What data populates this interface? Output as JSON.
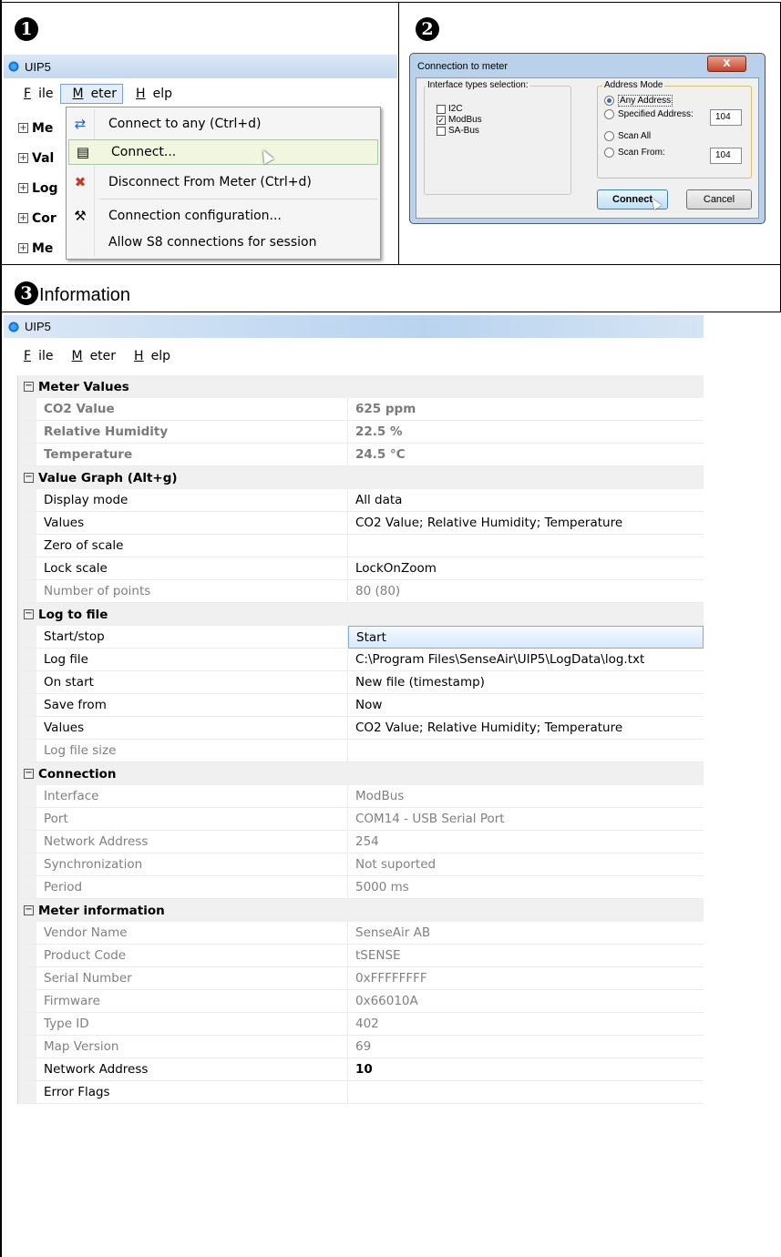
{
  "section_numbers": [
    "1",
    "2",
    "3"
  ],
  "section3_label": "Information",
  "window": {
    "title": "UIP5"
  },
  "menubar": {
    "file": "File",
    "meter": "Meter",
    "help": "Help"
  },
  "tree_collapsed": [
    "Me",
    "Val",
    "Log",
    "Cor",
    "Me"
  ],
  "meter_menu": {
    "items": [
      {
        "label": "Connect to any (Ctrl+d)",
        "icon": "connect-any-icon"
      },
      {
        "label": "Connect...",
        "icon": "connect-icon"
      },
      {
        "label": "Disconnect From Meter (Ctrl+d)",
        "icon": "disconnect-icon"
      },
      {
        "label": "Connection configuration...",
        "icon": "tools-icon"
      },
      {
        "label": "Allow S8 connections for session",
        "icon": ""
      }
    ]
  },
  "dialog": {
    "title": "Connection to meter",
    "close": "X",
    "interface_caption": "Interface types selection:",
    "interfaces": [
      {
        "label": "I2C",
        "checked": false
      },
      {
        "label": "ModBus",
        "checked": true
      },
      {
        "label": "SA-Bus",
        "checked": false
      }
    ],
    "address_caption": "Address Mode",
    "modes": [
      "Any Address",
      "Specified Address:",
      "Scan All",
      "Scan From:"
    ],
    "specified_value": "104",
    "scan_from_value": "104",
    "connect": "Connect",
    "cancel": "Cancel"
  },
  "grid": {
    "meter_values": {
      "title": "Meter Values",
      "rows": [
        {
          "k": "CO2 Value",
          "v": "625 ppm"
        },
        {
          "k": "Relative Humidity",
          "v": "22.5 %"
        },
        {
          "k": "Temperature",
          "v": "24.5 °C"
        }
      ]
    },
    "value_graph": {
      "title": "Value Graph (Alt+g)",
      "rows": [
        {
          "k": "Display mode",
          "v": "All data"
        },
        {
          "k": "Values",
          "v": "CO2 Value; Relative Humidity; Temperature"
        },
        {
          "k": "Zero of scale",
          "v": ""
        },
        {
          "k": "Lock scale",
          "v": "LockOnZoom"
        },
        {
          "k": "Number of points",
          "v": "80 (80)"
        }
      ]
    },
    "log_to_file": {
      "title": "Log to file",
      "rows": [
        {
          "k": "Start/stop",
          "v": "Start"
        },
        {
          "k": "Log file",
          "v": "C:\\Program Files\\SenseAir\\UIP5\\LogData\\log.txt"
        },
        {
          "k": "On start",
          "v": "New file (timestamp)"
        },
        {
          "k": "Save from",
          "v": "Now"
        },
        {
          "k": "Values",
          "v": "CO2 Value; Relative Humidity; Temperature"
        },
        {
          "k": "Log file size",
          "v": ""
        }
      ]
    },
    "connection": {
      "title": "Connection",
      "rows": [
        {
          "k": "Interface",
          "v": "ModBus"
        },
        {
          "k": "Port",
          "v": "COM14 - USB Serial Port"
        },
        {
          "k": "Network Address",
          "v": "254"
        },
        {
          "k": "Synchronization",
          "v": "Not suported"
        },
        {
          "k": "Period",
          "v": "5000 ms"
        }
      ]
    },
    "meter_information": {
      "title": "Meter information",
      "rows": [
        {
          "k": "Vendor Name",
          "v": "SenseAir AB"
        },
        {
          "k": "Product Code",
          "v": "tSENSE"
        },
        {
          "k": "Serial Number",
          "v": "0xFFFFFFFF"
        },
        {
          "k": "Firmware",
          "v": "0x66010A"
        },
        {
          "k": "Type ID",
          "v": "402"
        },
        {
          "k": "Map Version",
          "v": "69"
        },
        {
          "k": "Network Address",
          "v": "10"
        },
        {
          "k": "Error Flags",
          "v": ""
        }
      ]
    }
  }
}
